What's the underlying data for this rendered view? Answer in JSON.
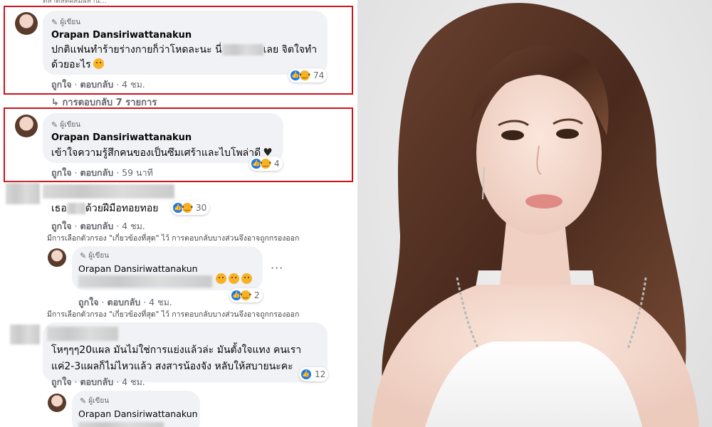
{
  "author_badge": "ผู้เขียน",
  "top_partial": "ตลาดสดผสมผสาน...",
  "comments": [
    {
      "name": "Orapan Dansiriwattanakun",
      "line1_before": "ปกติแฟนทำร้ายร่างกายก็ว่าโหดละนะ นี่",
      "line1_after": "เลย จิตใจทำ",
      "line2": "ด้วยอะไร",
      "reactions": "74",
      "meta_like": "ถูกใจ",
      "meta_reply": "ตอบกลับ",
      "meta_time": "4 ชม."
    },
    {
      "name": "Orapan Dansiriwattanakun",
      "line1": "เข้าใจความรู้สึกคนของเป็นซึมเศร้าและไบโพล่าดี",
      "reactions": "4",
      "meta_like": "ถูกใจ",
      "meta_reply": "ตอบกลับ",
      "meta_time": "59 นาที"
    },
    {
      "line1_before": "เธอ",
      "line1_after": "ด้วยฝีมือทอยทอย",
      "reactions": "30",
      "meta_like": "ถูกใจ",
      "meta_reply": "ตอบกลับ",
      "meta_time": "4 ชม."
    },
    {
      "name": "Orapan Dansiriwattanakun",
      "reactions": "2",
      "meta_like": "ถูกใจ",
      "meta_reply": "ตอบกลับ",
      "meta_time": "4 ชม."
    },
    {
      "line1": "โหๆๆๆ20แผล มันไม่ใช่การแย่งแล้วล่ะ มันตั้งใจแทง คนเรา",
      "line2": "แค่2-3แผลก็ไม่ไหวแล้ว สงสารน้องจัง หลับให้สบายนะคะ",
      "reactions": "12",
      "meta_like": "ถูกใจ",
      "meta_reply": "ตอบกลับ",
      "meta_time": "4 ชม."
    },
    {
      "name": "Orapan Dansiriwattanakun"
    }
  ],
  "replies_link": "การตอบกลับ 7 รายการ",
  "filter_note": "มีการเลือกตัวกรอง \"เกี่ยวข้องที่สุด\" ไว้ การตอบกลับบางส่วนจึงอาจถูกกรองออก",
  "colors": {
    "highlight_border": "#d0121b",
    "bubble": "#f0f2f5",
    "like_blue": "#1877f2",
    "sad_yellow": "#f7b125"
  }
}
